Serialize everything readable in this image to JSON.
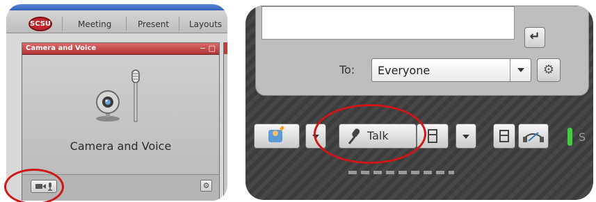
{
  "menubar": {
    "logo_text": "SCSU",
    "items": [
      {
        "label": "Meeting"
      },
      {
        "label": "Present"
      },
      {
        "label": "Layouts"
      }
    ]
  },
  "camera_voice_pod": {
    "title": "Camera and Voice",
    "window_controls": "− □",
    "body_label": "Camera and Voice",
    "footer": {
      "options_glyph": "⚙"
    }
  },
  "chat_pod": {
    "send_glyph": "↵",
    "to_label": "To:",
    "to_value": "Everyone",
    "options_glyph": "⚙"
  },
  "toolbar": {
    "talk_label": "Talk",
    "status_letter": "S"
  },
  "colors": {
    "pod_title_red": "#b23333",
    "annotation_red": "#d01616",
    "status_green": "#3fcc3f"
  }
}
